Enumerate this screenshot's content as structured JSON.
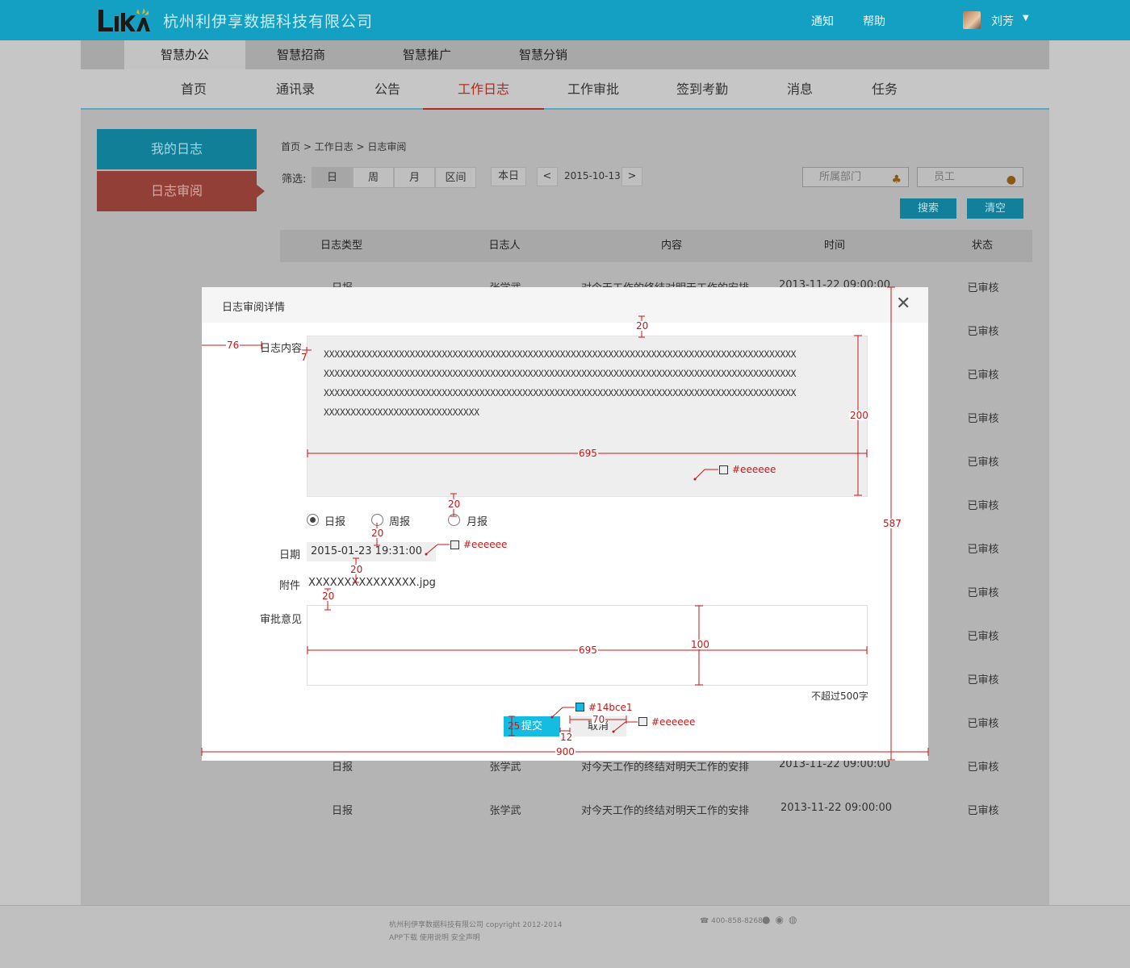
{
  "header": {
    "company": "杭州利伊享数据科技有限公司",
    "links": [
      "通知",
      "帮助"
    ],
    "user_name": "刘芳"
  },
  "categories": [
    "智慧办公",
    "智慧招商",
    "智慧推广",
    "智慧分销"
  ],
  "nav": [
    "首页",
    "通讯录",
    "公告",
    "工作日志",
    "工作审批",
    "签到考勤",
    "消息",
    "任务"
  ],
  "sidebar": {
    "items": [
      "我的日志",
      "日志审阅"
    ]
  },
  "breadcrumb": "首页 > 工作日志 > 日志审阅",
  "filter": {
    "label": "筛选:",
    "segments": [
      "日",
      "周",
      "月",
      "区间"
    ],
    "today": "本日",
    "prev": "<",
    "next": ">",
    "date": "2015-10-13",
    "dept_placeholder": "所属部门",
    "employee_placeholder": "员工",
    "search": "搜索",
    "clear": "清空"
  },
  "table": {
    "headers": [
      "日志类型",
      "日志人",
      "内容",
      "时间",
      "状态"
    ],
    "row": {
      "type": "日报",
      "person": "张学武",
      "content": "对今天工作的终结对明天工作的安排",
      "time": "2013-11-22  09:00:00",
      "status": "已审核"
    }
  },
  "modal": {
    "title": "日志审阅详情",
    "content_label": "日志内容",
    "content_lines": [
      "XXXXXXXXXXXXXXXXXXXXXXXXXXXXXXXXXXXXXXXXXXXXXXXXXXXXXXXXXXXXXXXXXXXXXXXXXXXXXXXXXXXXXXXX",
      "XXXXXXXXXXXXXXXXXXXXXXXXXXXXXXXXXXXXXXXXXXXXXXXXXXXXXXXXXXXXXXXXXXXXXXXXXXXXXXXXXXXXXXXX",
      "XXXXXXXXXXXXXXXXXXXXXXXXXXXXXXXXXXXXXXXXXXXXXXXXXXXXXXXXXXXXXXXXXXXXXXXXXXXXXXXXXXXXXXXX",
      "XXXXXXXXXXXXXXXXXXXXXXXXXXXXX"
    ],
    "radios": [
      "日报",
      "周报",
      "月报"
    ],
    "date_label": "日期",
    "date_value": "2015-01-23 19:31:00",
    "attach_label": "附件",
    "attach_value": "XXXXXXXXXXXXXXX.jpg",
    "opinion_label": "审批意见",
    "limit_note": "不超过500字",
    "submit": "提交",
    "cancel": "取消"
  },
  "annotations": {
    "d76": "76",
    "d7": "7",
    "d20": "20",
    "d200": "200",
    "d695": "695",
    "d587": "587",
    "d100": "100",
    "d25": "25",
    "d70": "70",
    "d12": "12",
    "d900": "900",
    "c_eee": "#eeeeee",
    "c_blue": "#14bce1"
  },
  "footer": {
    "line1": "杭州利伊享数据科技有限公司    copyright    2012-2014",
    "line2": "APP下载     使用说明     安全声明",
    "phone": "400-858-8268"
  },
  "colors": {
    "topbar": "#14a0c2",
    "accent_red": "#b02a22",
    "submit": "#14bce1",
    "box_bg": "#eeeeee",
    "annotation": "#c41818"
  }
}
